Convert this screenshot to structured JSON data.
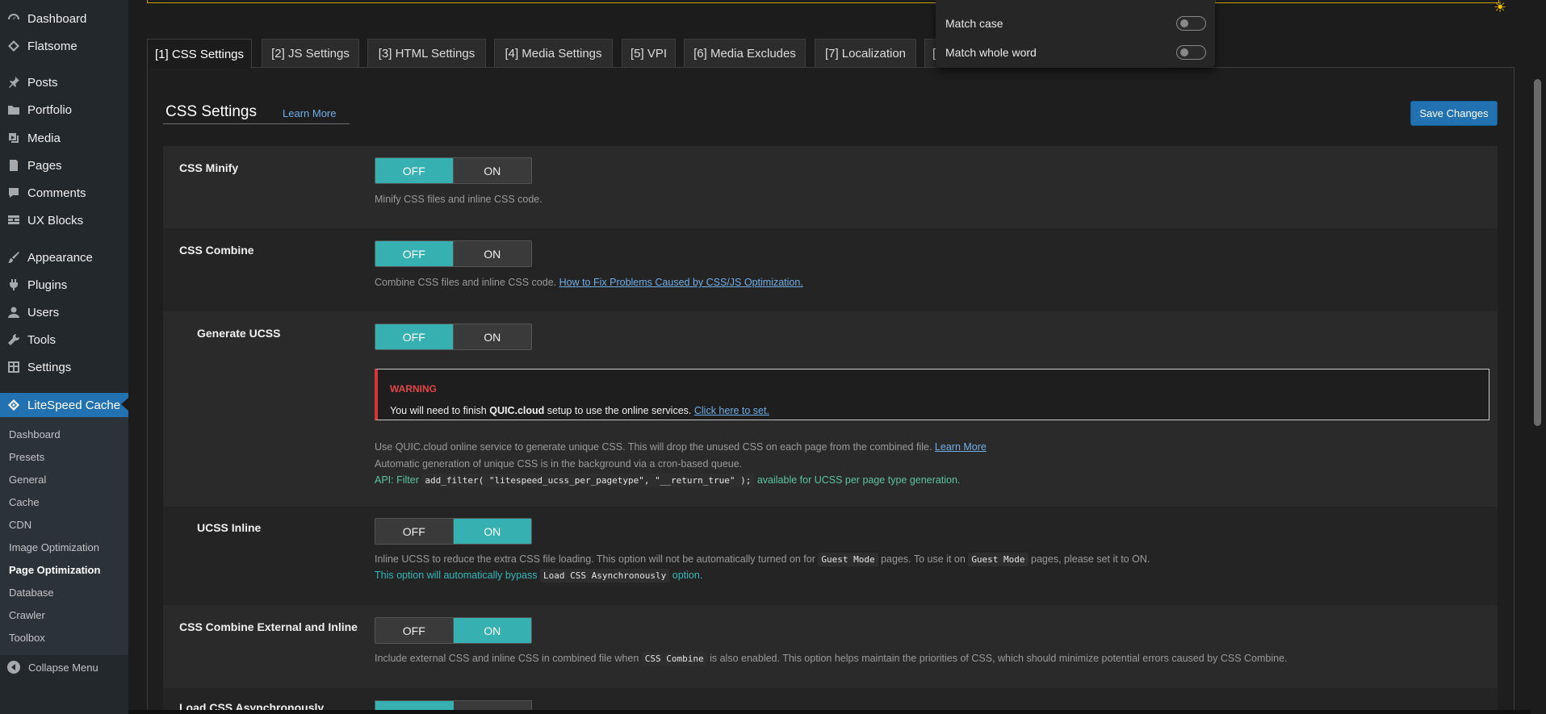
{
  "sidebar": {
    "items": [
      {
        "label": "Dashboard",
        "icon": "dashboard-icon"
      },
      {
        "label": "Flatsome",
        "icon": "diamond-icon"
      },
      {
        "label": "Posts",
        "icon": "pin-icon"
      },
      {
        "label": "Portfolio",
        "icon": "folder-icon"
      },
      {
        "label": "Media",
        "icon": "media-icon"
      },
      {
        "label": "Pages",
        "icon": "page-icon"
      },
      {
        "label": "Comments",
        "icon": "comment-icon"
      },
      {
        "label": "UX Blocks",
        "icon": "grid-icon"
      },
      {
        "label": "Appearance",
        "icon": "brush-icon"
      },
      {
        "label": "Plugins",
        "icon": "plug-icon"
      },
      {
        "label": "Users",
        "icon": "user-icon"
      },
      {
        "label": "Tools",
        "icon": "wrench-icon"
      },
      {
        "label": "Settings",
        "icon": "settings-icon"
      },
      {
        "label": "LiteSpeed Cache",
        "icon": "litespeed-icon"
      }
    ],
    "submenu": [
      "Dashboard",
      "Presets",
      "General",
      "Cache",
      "CDN",
      "Image Optimization",
      "Page Optimization",
      "Database",
      "Crawler",
      "Toolbox"
    ],
    "collapse_label": "Collapse Menu"
  },
  "tabs": [
    "[1] CSS Settings",
    "[2] JS Settings",
    "[3] HTML Settings",
    "[4] Media Settings",
    "[5] VPI",
    "[6] Media Excludes",
    "[7] Localization",
    "["
  ],
  "section": {
    "title": "CSS Settings",
    "learn_more": "Learn More",
    "save_label": "Save Changes"
  },
  "toggle": {
    "off": "OFF",
    "on": "ON"
  },
  "settings": {
    "css_minify": {
      "label": "CSS Minify",
      "state": "OFF",
      "desc": "Minify CSS files and inline CSS code."
    },
    "css_combine": {
      "label": "CSS Combine",
      "state": "OFF",
      "desc": "Combine CSS files and inline CSS code.",
      "link": "How to Fix Problems Caused by CSS/JS Optimization."
    },
    "generate_ucss": {
      "label": "Generate UCSS",
      "state": "OFF",
      "warning_title": "WARNING",
      "warning_pre": "You will need to finish",
      "warning_brand": "QUIC.cloud",
      "warning_post": "setup to use the online services.",
      "warning_link": "Click here to set.",
      "desc1": "Use QUIC.cloud online service to generate unique CSS. This will drop the unused CSS on each page from the combined file.",
      "desc1_link": "Learn More",
      "desc2": "Automatic generation of unique CSS is in the background via a cron-based queue.",
      "api_pre": "API: Filter",
      "api_code": "add_filter( \"litespeed_ucss_per_pagetype\", \"__return_true\" );",
      "api_post": "available for UCSS per page type generation."
    },
    "ucss_inline": {
      "label": "UCSS Inline",
      "state": "ON",
      "desc_a": "Inline UCSS to reduce the extra CSS file loading. This option will not be automatically turned on for",
      "code1": "Guest Mode",
      "desc_b": "pages. To use it on",
      "code2": "Guest Mode",
      "desc_c": "pages, please set it to ON.",
      "note_a": "This option will automatically bypass",
      "note_code": "Load CSS Asynchronously",
      "note_b": "option."
    },
    "css_combine_ext": {
      "label": "CSS Combine External and Inline",
      "state": "ON",
      "desc_a": "Include external CSS and inline CSS in combined file when",
      "code": "CSS Combine",
      "desc_b": "is also enabled. This option helps maintain the priorities of CSS, which should minimize potential errors caused by CSS Combine."
    },
    "load_css_async": {
      "label": "Load CSS Asynchronously"
    }
  },
  "find_popover": {
    "match_case": "Match case",
    "match_whole_word": "Match whole word"
  }
}
